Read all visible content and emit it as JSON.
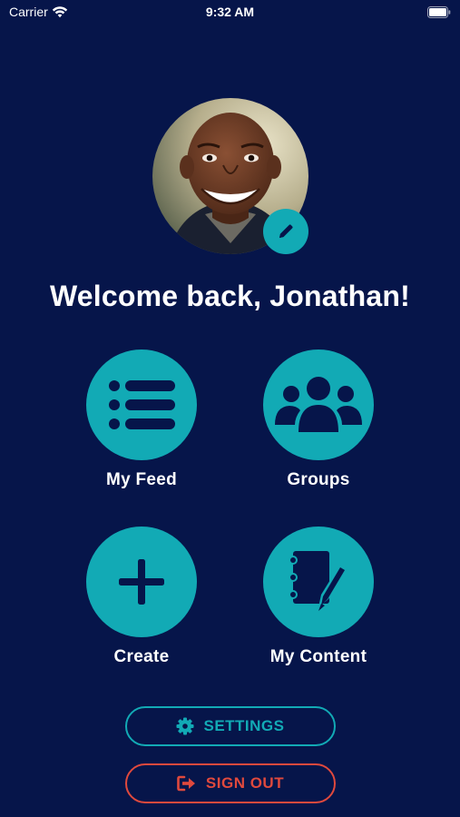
{
  "status_bar": {
    "carrier": "Carrier",
    "time": "9:32 AM",
    "wifi_icon": "wifi-icon",
    "battery_icon": "battery-icon"
  },
  "profile": {
    "avatar": "profile-photo",
    "edit_icon": "pencil-icon"
  },
  "welcome_text": "Welcome back, Jonathan!",
  "tiles": [
    {
      "label": "My Feed",
      "icon": "list-icon"
    },
    {
      "label": "Groups",
      "icon": "users-icon"
    },
    {
      "label": "Create",
      "icon": "plus-icon"
    },
    {
      "label": "My Content",
      "icon": "notebook-pen-icon"
    }
  ],
  "buttons": {
    "settings": {
      "label": "SETTINGS",
      "icon": "gear-icon"
    },
    "sign_out": {
      "label": "SIGN OUT",
      "icon": "sign-out-icon"
    }
  },
  "colors": {
    "background": "#06154a",
    "accent": "#12aab5",
    "danger": "#e0493d",
    "text": "#ffffff"
  }
}
